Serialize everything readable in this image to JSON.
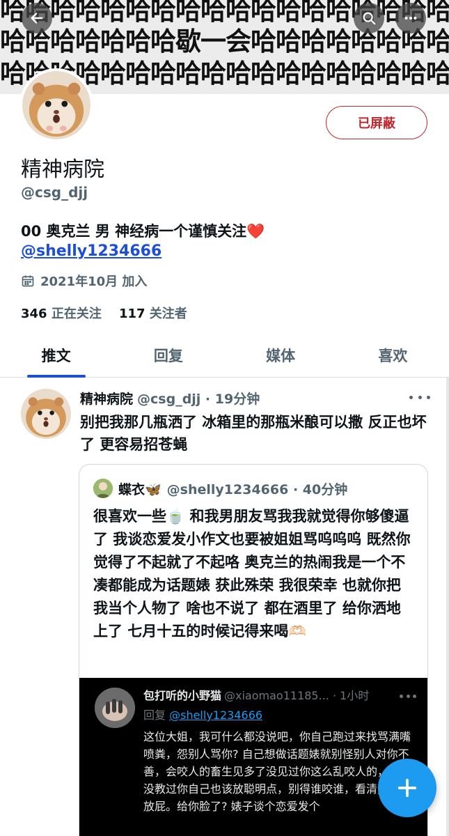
{
  "banner": {
    "lines": [
      "哈哈哈哈哈哈哈哈哈哈哈哈哈哈哈哈哈哈",
      "哈哈哈哈哈哈哈歇一会哈哈哈哈哈哈哈哈",
      "哈哈哈哈哈哈哈哈哈哈哈哈哈哈哈哈哈哈"
    ]
  },
  "toolbar": {
    "back_icon": "arrow-left-icon",
    "search_icon": "search-icon",
    "more_icon": "more-icon"
  },
  "profile": {
    "block_status": "已屏蔽",
    "display_name": "精神病院",
    "handle": "@csg_djj",
    "bio": "00 奥克兰 男 神经病一个谨慎关注❤️",
    "bio_link": "@shelly1234666",
    "joined": "2021年10月 加入",
    "following_count": "346",
    "following_label": "正在关注",
    "followers_count": "117",
    "followers_label": "关注者"
  },
  "tabs": [
    "推文",
    "回复",
    "媒体",
    "喜欢"
  ],
  "tweet": {
    "name": "精神病院",
    "meta": "@csg_djj · 19分钟",
    "text": "别把我那几瓶洒了 冰箱里的那瓶米酿可以撒 反正也坏了 更容易招苍蝇",
    "quote": {
      "name": "蝶衣🦋",
      "meta": "@shelly1234666 · 40分钟",
      "text": "很喜欢一些🍵 和我男朋友骂我我就觉得你够傻逼了 我谈恋爱发小作文也要被姐姐骂呜呜呜 既然你觉得了不起就了不起咯 奥克兰的热闹我是一个不凑都能成为话题婊 获此殊荣 我很荣幸 也就你把我当个人物了 啥也不说了 都在酒里了 给你洒地上了 七月十五的时候记得来喝🫶🏻",
      "embedded": {
        "name": "包打听的小野猫",
        "meta": "@xiaomao11185... · 1小时",
        "reply_prefix": "回复",
        "reply_mention": "@shelly1234666",
        "text": "这位大姐，我可什么都没说吧，你自己跑过来找骂满嘴喷粪，怨别人骂你? 自己想做话题婊就别怪别人对你不善，会咬人的畜生见多了没见过你这么乱咬人的，你妈没教过你自己也该放聪明点，别得谁咬谁，看清楚人再放屁。给你脸了? 婊子谈个恋爱发个"
      }
    }
  },
  "fab": {
    "icon": "plus-icon"
  },
  "colors": {
    "accent": "#1d9bf0",
    "blocked": "#c0262d",
    "tab_indicator": "#1d4ed8"
  }
}
